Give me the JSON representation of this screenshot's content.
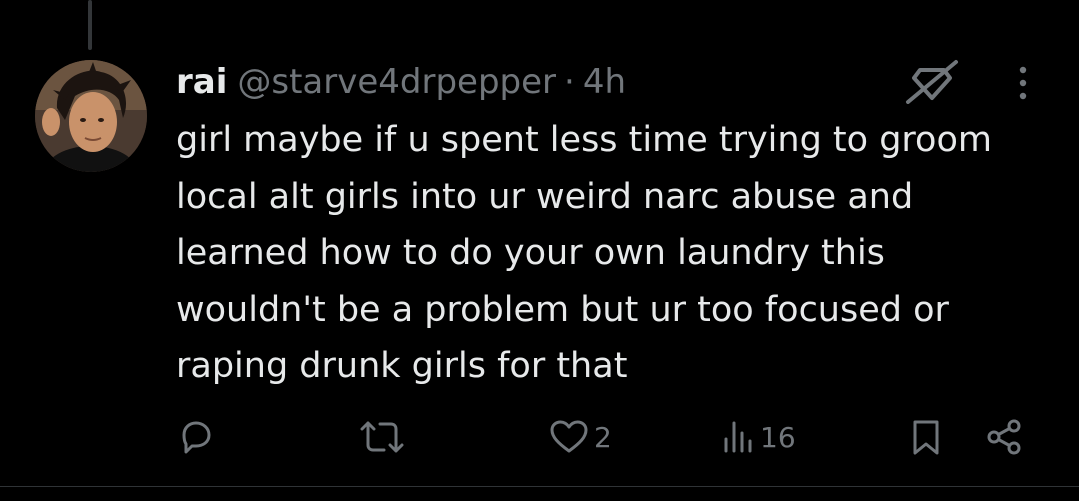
{
  "tweet": {
    "display_name": "rai",
    "handle": "@starve4drpepper",
    "separator": "·",
    "timestamp": "4h",
    "text": "girl maybe if u spent less time trying to groom\nlocal alt girls into ur weird narc abuse and\nlearned how to do your own laundry this\nwouldn't be a problem but ur too focused or\nraping drunk girls for that"
  },
  "icons": {
    "header": [
      "verified-slash-icon",
      "more-options-icon"
    ],
    "actions": [
      "reply-icon",
      "retweet-icon",
      "like-icon",
      "views-icon",
      "bookmark-icon",
      "share-icon"
    ]
  },
  "actions": {
    "like_count": "2",
    "view_count": "16"
  },
  "colors": {
    "background": "#000000",
    "text_primary": "#e7e9ea",
    "text_secondary": "#71767b",
    "divider": "#2f3336"
  }
}
